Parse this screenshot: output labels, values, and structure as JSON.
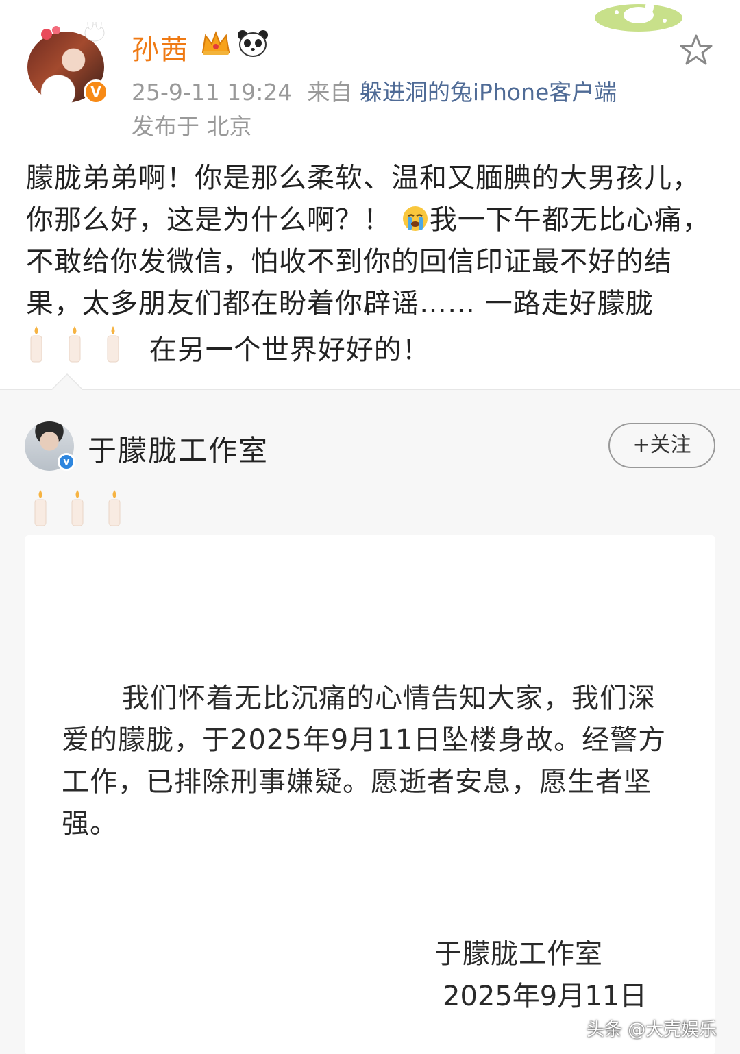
{
  "post": {
    "author": "孙茜",
    "timestamp": "25-9-11 19:24",
    "from_label": "来自",
    "source": "躲进洞的兔iPhone客户端",
    "location": "发布于 北京",
    "text_part1": "朦胧弟弟啊！你是那么柔软、温和又腼腆的大男孩儿，你那么好，这是为什么啊？！",
    "text_part2": "我一下午都无比心痛，不敢给你发微信，怕收不到你的回信印证最不好的结果，太多朋友们都在盼着你辟谣…… 一路走好朦胧",
    "text_part3": "在另一个世界好好的！"
  },
  "repost": {
    "author": "于朦胧工作室",
    "follow_label": "+关注",
    "statement": "我们怀着无比沉痛的心情告知大家，我们深爱的朦胧，于2025年9月11日坠楼身故。经警方工作，已排除刑事嫌疑。愿逝者安息，愿生者坚强。",
    "signature": "于朦胧工作室",
    "date": "2025年9月11日"
  },
  "watermark": "头条 @大壳娱乐",
  "icons": {
    "verified": "orange-v-badge",
    "crown": "crown-icon",
    "panda": "panda-icon",
    "star": "favorite-star-icon",
    "crying": "crying-face-emoji",
    "candle": "candle-emoji"
  },
  "colors": {
    "author_name": "#ef7a14",
    "source_link": "#4f6b96",
    "meta_gray": "#999999",
    "repost_bg": "#f7f7f7"
  }
}
